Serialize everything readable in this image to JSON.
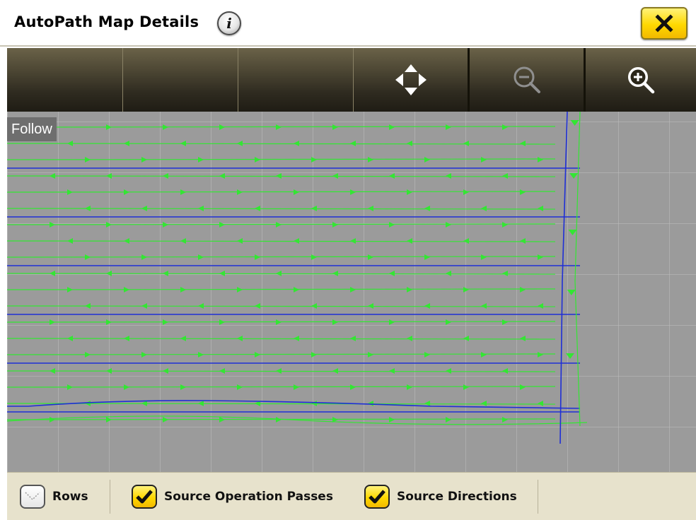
{
  "window": {
    "title": "AutoPath Map Details"
  },
  "icons": {
    "info": "info-icon",
    "close": "close-x-icon",
    "pan": "pan-arrows-icon",
    "zoom_out": "zoom-out-icon",
    "zoom_in": "zoom-in-icon",
    "checkbox_checked": "checkmark-icon",
    "checkbox_unchecked": "rows-dots-icon"
  },
  "info_glyph": "i",
  "map": {
    "mode_label": "Follow"
  },
  "bottom": {
    "options": [
      {
        "label": "Rows",
        "checked": false
      },
      {
        "label": "Source Operation Passes",
        "checked": true
      },
      {
        "label": "Source Directions",
        "checked": true
      }
    ]
  },
  "colors": {
    "accent_yellow": "#ffd800",
    "pass_line_green": "#33e633",
    "row_line_blue": "#1f2fd6",
    "map_background": "#9b9b9b",
    "toolbar_dark": "#2f2b20",
    "bottom_bar": "#e7e2cc"
  }
}
